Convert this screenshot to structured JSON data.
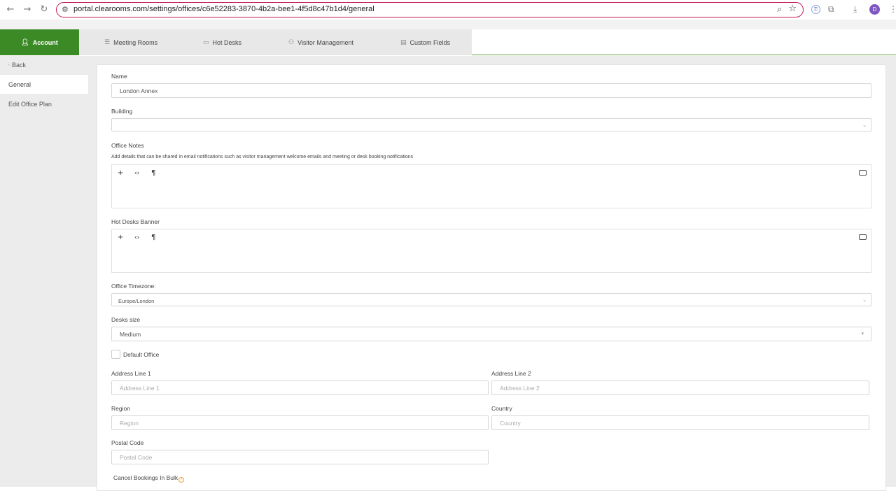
{
  "browser": {
    "url": "portal.clearooms.com/settings/offices/c6e52283-3870-4b2a-bee1-4f5d8c47b1d4/general",
    "avatar_initial": "D"
  },
  "tabs": {
    "account": "Account",
    "meeting_rooms": "Meeting Rooms",
    "hot_desks": "Hot Desks",
    "visitor_management": "Visitor Management",
    "custom_fields": "Custom Fields"
  },
  "sidebar": {
    "back": "Back",
    "items": [
      "General",
      "Edit Office Plan"
    ]
  },
  "form": {
    "name_label": "Name",
    "name_value": "London Annex",
    "building_label": "Building",
    "building_value": "",
    "office_notes_label": "Office Notes",
    "office_notes_hint": "Add details that can be shared in email notifications such as visitor management welcome emails and meeting or desk booking notifications",
    "hot_desks_banner_label": "Hot Desks Banner",
    "timezone_label": "Office Timezone:",
    "timezone_value": "Europe/London",
    "desks_size_label": "Desks size",
    "desks_size_value": "Medium",
    "default_office_label": "Default Office",
    "address1_label": "Address Line 1",
    "address1_placeholder": "Address Line 1",
    "address2_label": "Address Line 2",
    "address2_placeholder": "Address Line 2",
    "region_label": "Region",
    "region_placeholder": "Region",
    "country_label": "Country",
    "country_placeholder": "Country",
    "postal_label": "Postal Code",
    "postal_placeholder": "Postal Code",
    "cancel_bulk_label": "Cancel Bookings In Bulk"
  },
  "colors": {
    "accent_green": "#3c8a25",
    "omnibox_border": "#c2185b"
  }
}
